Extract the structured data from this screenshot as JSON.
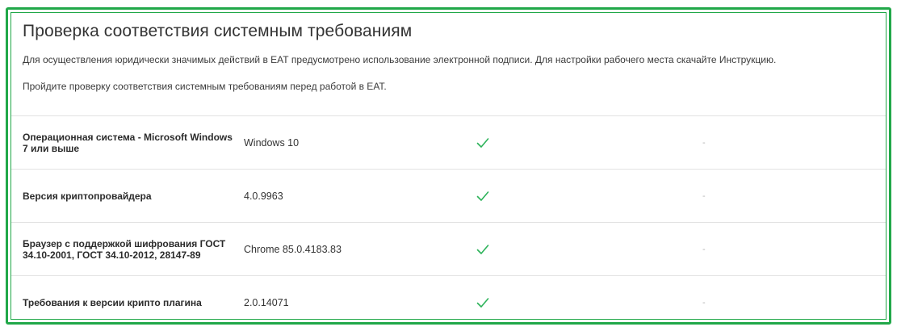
{
  "page": {
    "title": "Проверка соответствия системным требованиям",
    "description_1": "Для осуществления юридически значимых действий в ЕАТ предусмотрено использование электронной подписи. Для настройки рабочего места скачайте Инструкцию.",
    "description_2": "Пройдите проверку соответствия системным требованиям перед работой в ЕАТ."
  },
  "requirements": [
    {
      "name": "Операционная система - Microsoft Windows 7 или выше",
      "value": "Windows 10",
      "status": "ok",
      "status_icon": "check-icon",
      "note": "-"
    },
    {
      "name": "Версия криптопровайдера",
      "value": "4.0.9963",
      "status": "ok",
      "status_icon": "check-icon",
      "note": "-"
    },
    {
      "name": "Браузер с поддержкой шифрования ГОСТ 34.10-2001, ГОСТ 34.10-2012, 28147-89",
      "value": "Chrome 85.0.4183.83",
      "status": "ok",
      "status_icon": "check-icon",
      "note": "-"
    },
    {
      "name": "Требования к версии крипто плагина",
      "value": "2.0.14071",
      "status": "ok",
      "status_icon": "check-icon",
      "note": "-"
    }
  ],
  "colors": {
    "frame_border": "#21a849",
    "check": "#2db35a",
    "row_divider": "#e2e2e2",
    "muted_text": "#b5b5b5"
  }
}
